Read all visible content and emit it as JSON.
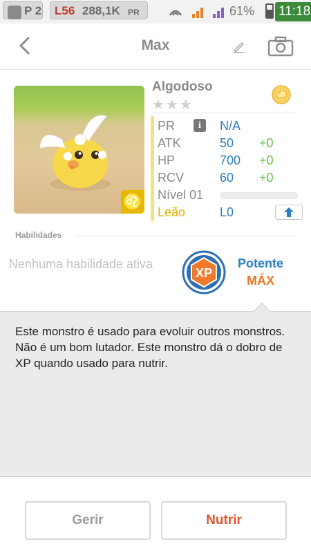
{
  "status_bar": {
    "profile_rank": "P 2",
    "level": "L56",
    "power": "288,1K",
    "power_suffix": "PR",
    "battery": "61%",
    "clock": "11:18"
  },
  "header": {
    "title": "Max"
  },
  "monster": {
    "name": "Algodoso",
    "stars": "★★★",
    "zodiac_symbol": "♌",
    "stats": [
      {
        "label": "PR",
        "value": "N/A",
        "bonus": ""
      },
      {
        "label": "ATK",
        "value": "50",
        "bonus": "+0"
      },
      {
        "label": "HP",
        "value": "700",
        "bonus": "+0"
      },
      {
        "label": "RCV",
        "value": "60",
        "bonus": "+0"
      }
    ],
    "level_label": "Nível 01",
    "level_progress": 0,
    "zodiac_label": "Leão",
    "zodiac_level": "L0"
  },
  "skills": {
    "header": "Habilidades",
    "none_text": "Nenhuma habilidade ativa",
    "leader_badge": "XP",
    "leader_name": "Potente",
    "leader_level": "MÁX"
  },
  "description": {
    "text": "Este monstro é usado para evoluir outros monstros. Não é um bom lutador. Este monstro dá o dobro de XP quando usado para nutrir."
  },
  "actions": {
    "manage_label": "Gerir",
    "feed_label": "Nutrir"
  },
  "colors": {
    "accent_blue": "#2d7fc0",
    "accent_orange": "#e2532a",
    "bonus_green": "#6cbf4a",
    "zodiac_gold": "#e0b400"
  },
  "icons": [
    "back-arrow-icon",
    "edit-pencil-icon",
    "camera-icon",
    "cloud-element-icon",
    "info-icon",
    "upgrade-arrow-icon",
    "xp-badge-icon"
  ]
}
